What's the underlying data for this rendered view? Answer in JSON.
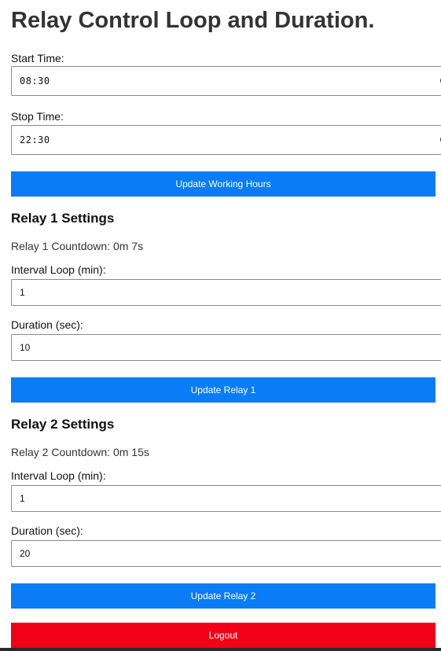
{
  "page": {
    "title": "Relay Control Loop and Duration."
  },
  "working_hours": {
    "start_label": "Start Time:",
    "start_value": "08:30",
    "stop_label": "Stop Time:",
    "stop_value": "22:30",
    "update_label": "Update Working Hours"
  },
  "relay1": {
    "title": "Relay 1 Settings",
    "countdown": "Relay 1 Countdown: 0m 7s",
    "interval_label": "Interval Loop (min):",
    "interval_value": "1",
    "duration_label": "Duration (sec):",
    "duration_value": "10",
    "update_label": "Update Relay 1"
  },
  "relay2": {
    "title": "Relay 2 Settings",
    "countdown": "Relay 2 Countdown: 0m 15s",
    "interval_label": "Interval Loop (min):",
    "interval_value": "1",
    "duration_label": "Duration (sec):",
    "duration_value": "20",
    "update_label": "Update Relay 2"
  },
  "logout": {
    "label": "Logout"
  },
  "colors": {
    "primary_button": "#0a7cf5",
    "logout_button": "#f20016"
  },
  "icons": {
    "time_input": "clock-icon"
  }
}
